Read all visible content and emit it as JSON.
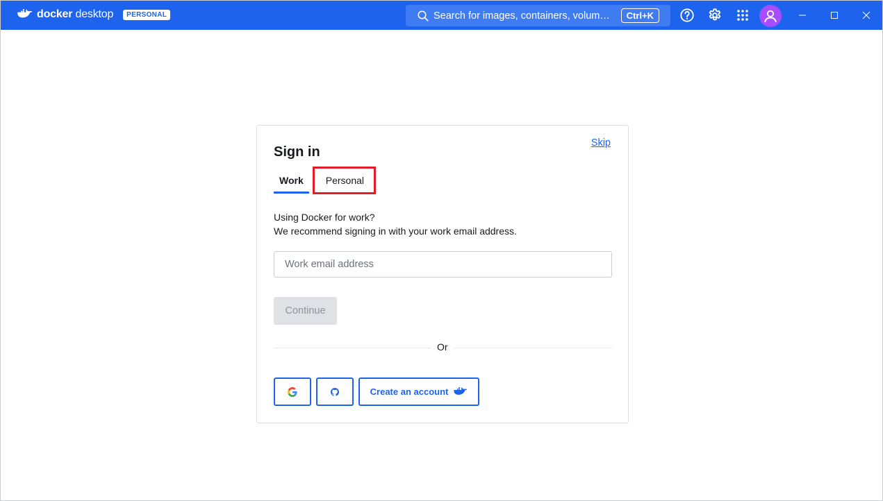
{
  "app": {
    "brand_name_bold": "docker",
    "brand_name_light": " desktop",
    "plan_badge": "PERSONAL"
  },
  "search": {
    "placeholder": "Search for images, containers, volume...",
    "shortcut": "Ctrl+K"
  },
  "signin": {
    "skip_label": "Skip",
    "title": "Sign in",
    "tabs": [
      {
        "label": "Work",
        "active": true
      },
      {
        "label": "Personal",
        "active": false
      }
    ],
    "description_line1": "Using Docker for work?",
    "description_line2": "We recommend signing in with your work email address.",
    "email_placeholder": "Work email address",
    "continue_label": "Continue",
    "or_label": "Or",
    "create_account_label": "Create an account"
  },
  "icons": {
    "search": "search-icon",
    "help": "help-icon",
    "settings": "gear-icon",
    "apps": "grid-icon",
    "account": "user-avatar-icon",
    "google": "google-icon",
    "github": "github-icon",
    "docker": "docker-whale-icon"
  },
  "colors": {
    "titlebar": "#1d63ed",
    "accent": "#1d63ed",
    "highlight": "#e11d2a",
    "avatar": "#a64dff"
  }
}
